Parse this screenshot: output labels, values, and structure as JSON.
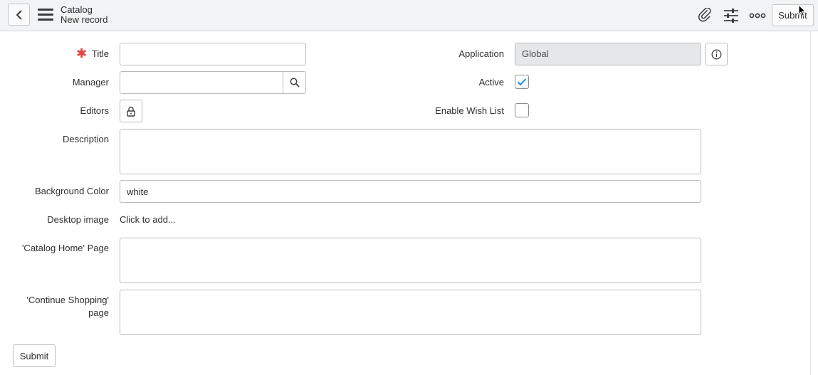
{
  "header": {
    "title": "Catalog",
    "subtitle": "New record",
    "submit_label": "Submit",
    "icons": [
      "back-icon",
      "hamburger-menu-icon",
      "paperclip-icon",
      "sliders-icon",
      "more-options-icon"
    ]
  },
  "form": {
    "title": {
      "label": "Title",
      "required_mark": "✱",
      "value": ""
    },
    "manager": {
      "label": "Manager",
      "value": ""
    },
    "editors": {
      "label": "Editors"
    },
    "description": {
      "label": "Description",
      "value": ""
    },
    "background_color": {
      "label": "Background Color",
      "value": "white"
    },
    "desktop_image": {
      "label": "Desktop image",
      "action": "Click to add..."
    },
    "catalog_home_page": {
      "label": "'Catalog Home' Page",
      "value": ""
    },
    "continue_shopping_page": {
      "label_line1": "'Continue Shopping'",
      "label_line2": "page",
      "value": ""
    },
    "application": {
      "label": "Application",
      "value": "Global"
    },
    "active": {
      "label": "Active",
      "checked": true
    },
    "enable_wish_list": {
      "label": "Enable Wish List",
      "checked": false
    }
  },
  "footer": {
    "submit_label": "Submit"
  },
  "colors": {
    "accent": "#1f8ae6",
    "required": "#e8423b",
    "header_bg": "#f2f3f4"
  }
}
